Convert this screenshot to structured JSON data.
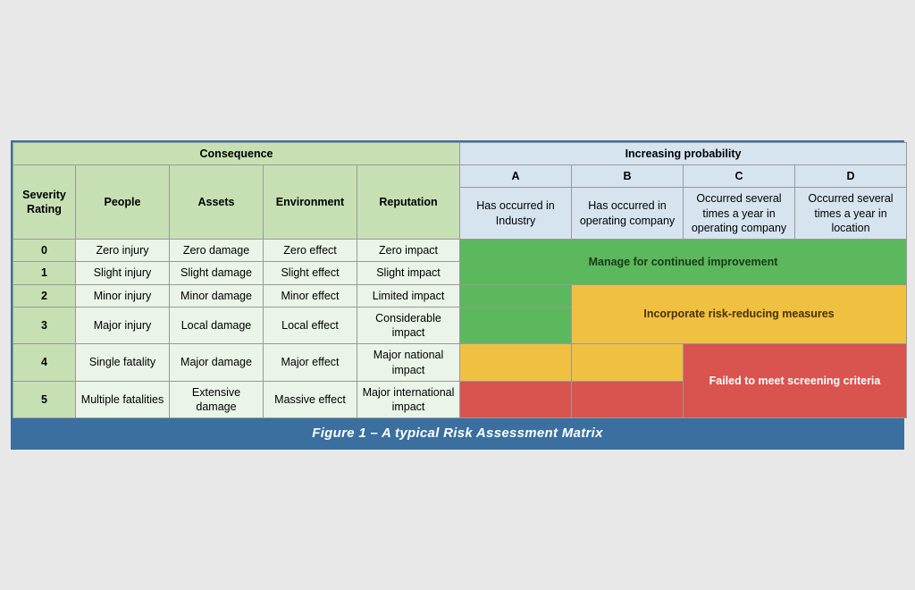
{
  "caption": "Figure 1 – A typical Risk Assessment Matrix",
  "headers": {
    "consequence": "Consequence",
    "probability": "Increasing probability",
    "severity_rating": "Severity Rating",
    "people": "People",
    "assets": "Assets",
    "environment": "Environment",
    "reputation": "Reputation",
    "col_a_letter": "A",
    "col_b_letter": "B",
    "col_c_letter": "C",
    "col_d_letter": "D",
    "col_a_desc": "Has occurred in Industry",
    "col_b_desc": "Has occurred in operating company",
    "col_c_desc": "Occurred several times a year in operating company",
    "col_d_desc": "Occurred several times a year in location"
  },
  "rows": [
    {
      "severity": "0",
      "people": "Zero injury",
      "assets": "Zero damage",
      "environment": "Zero effect",
      "reputation": "Zero impact"
    },
    {
      "severity": "1",
      "people": "Slight injury",
      "assets": "Slight damage",
      "environment": "Slight effect",
      "reputation": "Slight impact"
    },
    {
      "severity": "2",
      "people": "Minor injury",
      "assets": "Minor damage",
      "environment": "Minor effect",
      "reputation": "Limited impact"
    },
    {
      "severity": "3",
      "people": "Major injury",
      "assets": "Local damage",
      "environment": "Local effect",
      "reputation": "Considerable impact"
    },
    {
      "severity": "4",
      "people": "Single fatality",
      "assets": "Major damage",
      "environment": "Major effect",
      "reputation": "Major national impact"
    },
    {
      "severity": "5",
      "people": "Multiple fatalities",
      "assets": "Extensive damage",
      "environment": "Massive effect",
      "reputation": "Major international impact"
    }
  ],
  "zones": {
    "manage": "Manage for continued improvement",
    "incorporate": "Incorporate risk-reducing measures",
    "failed": "Failed to meet screening criteria"
  }
}
